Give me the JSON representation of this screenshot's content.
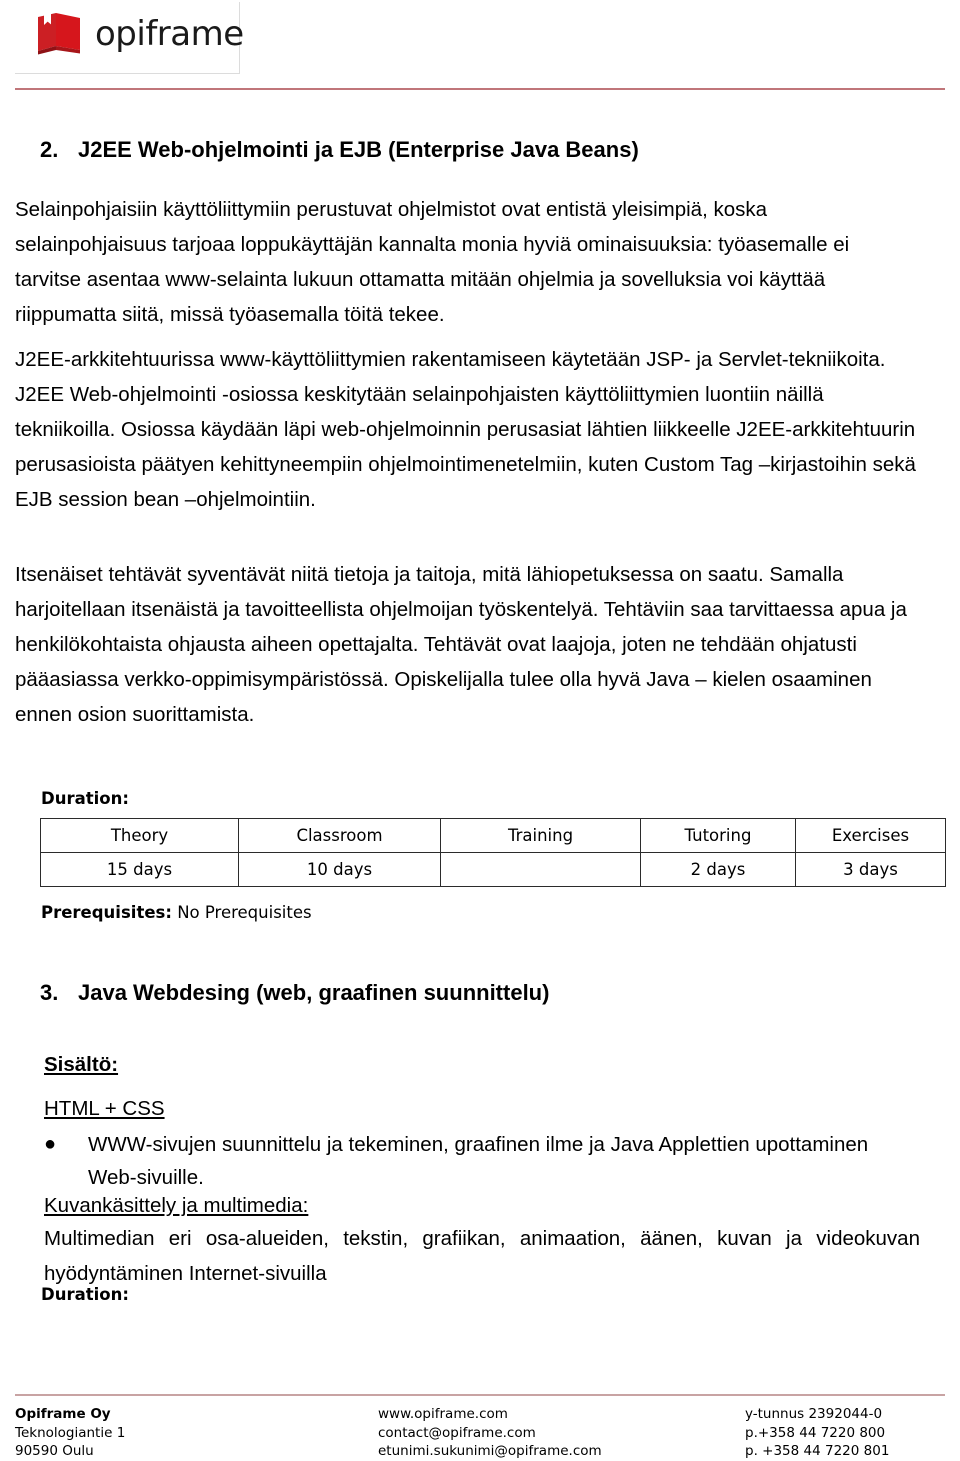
{
  "header": {
    "logo_word": "opiframe",
    "logo_icon": "book-logo-icon",
    "brand_color": "#cc1f24",
    "rule_color": "#c0767a"
  },
  "sections": [
    {
      "number": "2.",
      "title": "J2EE Web-ohjelmointi ja EJB (Enterprise Java Beans)",
      "paragraphs": [
        "Selainpohjaisiin käyttöliittymiin perustuvat ohjelmistot ovat entistä yleisimpiä, koska selainpohjaisuus tarjoaa loppukäyttäjän kannalta monia hyviä ominaisuuksia: työasemalle ei tarvitse asentaa www-selainta lukuun ottamatta mitään ohjelmia ja sovelluksia voi käyttää riippumatta siitä, missä työasemalla töitä tekee.",
        "J2EE-arkkitehtuurissa www-käyttöliittymien rakentamiseen käytetään JSP- ja Servlet-tekniikoita. J2EE Web-ohjelmointi -osiossa keskitytään selainpohjaisten käyttöliittymien luontiin näillä tekniikoilla. Osiossa käydään läpi web-ohjelmoinnin perusasiat lähtien liikkeelle J2EE-arkkitehtuurin perusasioista päätyen kehittyneempiin ohjelmointimenetelmiin, kuten Custom Tag –kirjastoihin sekä EJB session bean –ohjelmointiin.",
        "Itsenäiset tehtävät syventävät niitä tietoja ja taitoja, mitä lähiopetuksessa on saatu. Samalla harjoitellaan itsenäistä ja tavoitteellista ohjelmoijan työskentelyä. Tehtäviin saa tarvittaessa apua ja henkilökohtaista ohjausta aiheen opettajalta. Tehtävät ovat laajoja, joten ne tehdään ohjatusti pääasiassa verkko-oppimisympäristössä. Opiskelijalla tulee olla hyvä Java – kielen osaaminen ennen osion suorittamista."
      ],
      "duration_label": "Duration:",
      "duration_table": {
        "headers": [
          "Theory",
          "Classroom",
          "Training",
          "Tutoring",
          "Exercises"
        ],
        "values": [
          "15 days",
          "10 days",
          "",
          "2 days",
          "3 days"
        ]
      },
      "prerequisites_label": "Prerequisites:",
      "prerequisites_value": "No Prerequisites"
    },
    {
      "number": "3.",
      "title": "Java Webdesing (web, graafinen suunnittelu)",
      "sisalto_label": "Sisältö:",
      "sub1_label": "HTML + CSS",
      "bullet1": "WWW-sivujen suunnittelu ja tekeminen, graafinen ilme ja Java Applettien upottaminen Web-sivuille.",
      "sub2_label": "Kuvankäsittely ja multimedia:",
      "sub2_text": "Multimedian eri osa-alueiden, tekstin, grafiikan, animaation, äänen, kuvan ja videokuvan hyödyntäminen Internet-sivuilla",
      "duration_label": "Duration:"
    }
  ],
  "footer": {
    "col1": [
      "Opiframe Oy",
      "Teknologiantie 1",
      "90590 Oulu"
    ],
    "col2": [
      "www.opiframe.com",
      "contact@opiframe.com",
      "etunimi.sukunimi@opiframe.com"
    ],
    "col3": [
      "y-tunnus 2392044-0",
      "p.+358 44 7220 800",
      "p. +358 44 7220 801"
    ],
    "rule_color": "#c8a3a3"
  }
}
